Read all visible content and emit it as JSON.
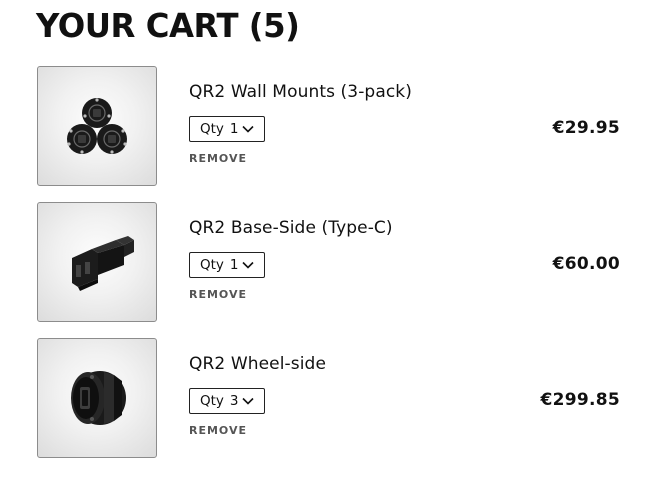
{
  "cart": {
    "title": "YOUR CART (5)",
    "qty_label": "Qty",
    "remove_label": "REMOVE",
    "items": [
      {
        "name": "QR2 Wall Mounts (3-pack)",
        "qty": "1",
        "price": "€29.95",
        "image_icon": "wall-mounts-image"
      },
      {
        "name": "QR2 Base-Side (Type-C)",
        "qty": "1",
        "price": "€60.00",
        "image_icon": "base-side-image"
      },
      {
        "name": "QR2 Wheel-side",
        "qty": "3",
        "price": "€299.85",
        "image_icon": "wheel-side-image"
      }
    ]
  },
  "colors": {
    "text": "#111111",
    "muted": "#555555",
    "border": "#8c8c8c",
    "background": "#ffffff"
  }
}
